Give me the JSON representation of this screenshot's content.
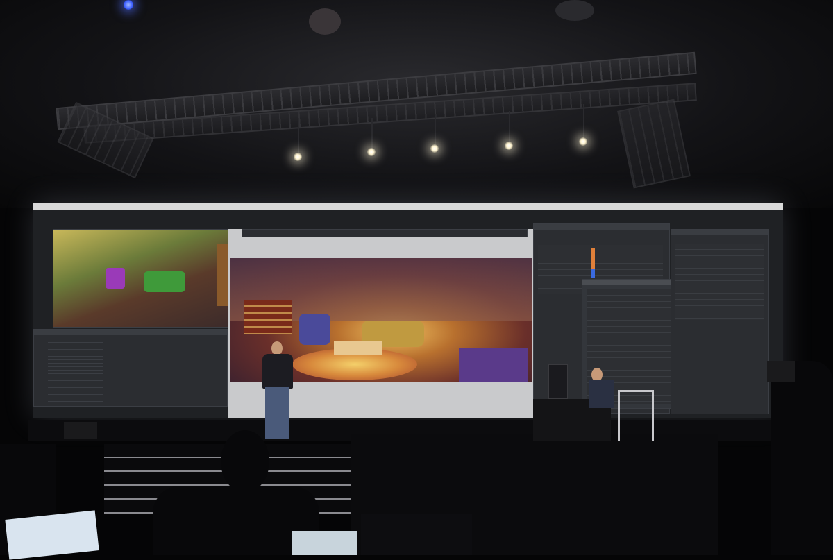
{
  "scene": "",
  "colors": {
    "background": "#050506",
    "screen": "#1f2124",
    "panel": "#2b2d31",
    "render_warm": "#d88a3c",
    "render_purple": "#6a2f6a",
    "stage_light": "#fff4d0"
  },
  "screen_ui": {
    "outliner_rows": 18,
    "inspector_rows": 12
  }
}
